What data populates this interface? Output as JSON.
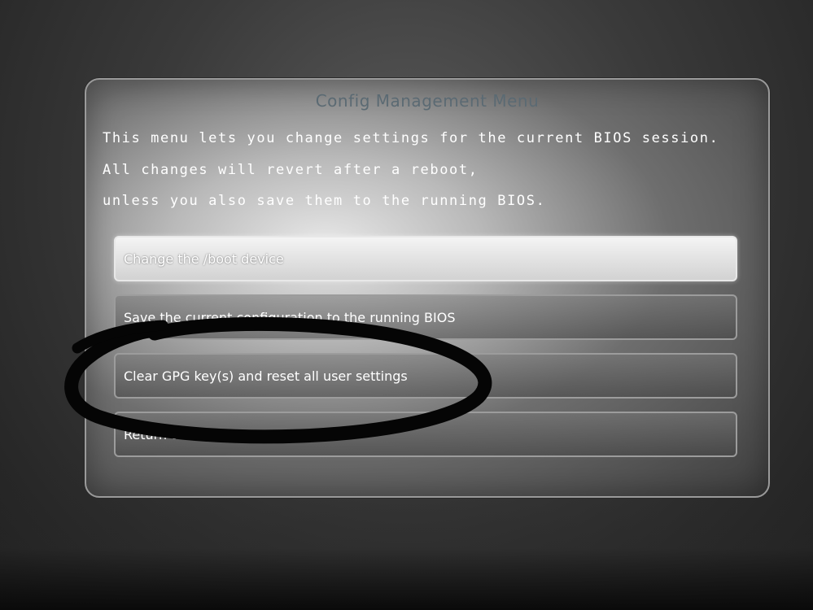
{
  "dialog": {
    "title": "Config Management Menu",
    "description": [
      "This menu lets you change settings for the current BIOS session.",
      "All changes will revert after a reboot,",
      "unless you also save them to the running BIOS."
    ]
  },
  "menu": {
    "selected_index": 0,
    "items": [
      {
        "label": "Change the /boot device"
      },
      {
        "label": "Save the current configuration to the running BIOS"
      },
      {
        "label": "Clear GPG key(s) and reset all user settings"
      },
      {
        "label": "Return to main menu"
      }
    ]
  },
  "annotation": {
    "kind": "hand-drawn circle",
    "color": "#050505"
  },
  "colors": {
    "title": "#5b6a73",
    "text": "#ffffff",
    "selected_item_bg": "#e6e6e6"
  }
}
